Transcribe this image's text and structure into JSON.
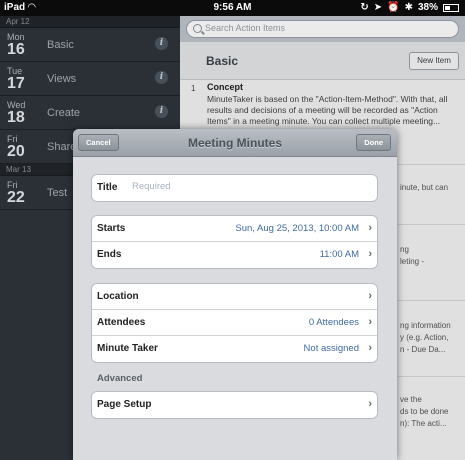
{
  "status_bar": {
    "carrier": "iPad",
    "time": "9:56 AM",
    "battery": "38%",
    "battery_level": 0.38
  },
  "sidebar": {
    "sections": [
      {
        "header": "Apr 12",
        "items": [
          {
            "dow": "Mon",
            "day": "16",
            "title": "Basic"
          },
          {
            "dow": "Tue",
            "day": "17",
            "title": "Views"
          },
          {
            "dow": "Wed",
            "day": "18",
            "title": "Create"
          },
          {
            "dow": "Fri",
            "day": "20",
            "title": "Share"
          }
        ]
      },
      {
        "header": "Mar 13",
        "items": [
          {
            "dow": "Fri",
            "day": "22",
            "title": "Test"
          }
        ]
      }
    ]
  },
  "main": {
    "search_placeholder": "Search Action Items",
    "toolbar_title": "Basic",
    "new_item_label": "New Item",
    "concept": {
      "number": "1",
      "title": "Concept",
      "body": "MinuteTaker is based on the \"Action-Item-Method\". With that, all results and decisions of a meeting will be recorded as \"Action Items\" in a meeting minute.  You can collect multiple meeting..."
    },
    "background_fragments": [
      "inute, but can",
      "ng",
      "leting -",
      "ng information",
      "y (e.g. Action,",
      "n - Due Da...",
      "ve the",
      "ds to be done",
      "n): The acti..."
    ]
  },
  "modal": {
    "title": "Meeting Minutes",
    "cancel_label": "Cancel",
    "done_label": "Done",
    "title_field": {
      "label": "Title",
      "placeholder": "Required"
    },
    "starts": {
      "label": "Starts",
      "value": "Sun, Aug 25, 2013, 10:00 AM"
    },
    "ends": {
      "label": "Ends",
      "value": "11:00 AM"
    },
    "location": {
      "label": "Location",
      "value": ""
    },
    "attendees": {
      "label": "Attendees",
      "value": "0 Attendees"
    },
    "minute_taker": {
      "label": "Minute Taker",
      "value": "Not assigned"
    },
    "advanced_label": "Advanced",
    "page_setup": {
      "label": "Page Setup"
    }
  }
}
